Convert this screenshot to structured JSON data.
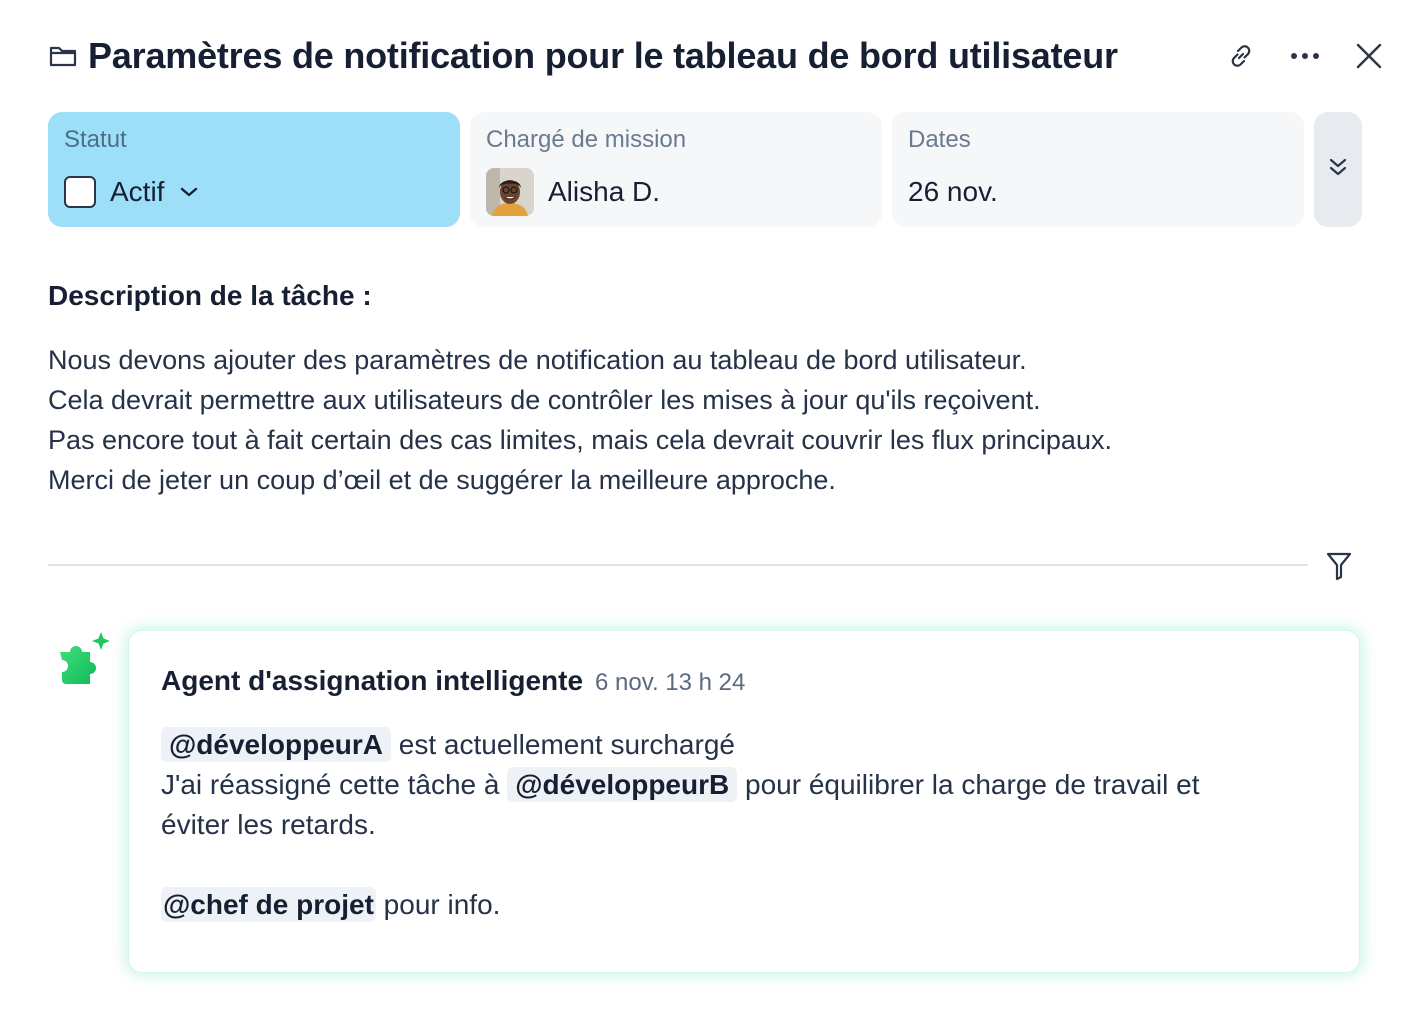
{
  "header": {
    "title": "Paramètres de notification pour le tableau de bord utilisateur",
    "icons": [
      "folder-icon",
      "link-icon",
      "more-icon",
      "close-icon"
    ]
  },
  "fields": {
    "status": {
      "label": "Statut",
      "value": "Actif",
      "color": "#9ddff9"
    },
    "assignee": {
      "label": "Chargé de mission",
      "value": "Alisha D."
    },
    "dates": {
      "label": "Dates",
      "value": "26 nov."
    }
  },
  "description": {
    "title": "Description de la tâche :",
    "lines": [
      "Nous devons ajouter des paramètres de notification au tableau de bord utilisateur.",
      "Cela devrait permettre aux utilisateurs de contrôler les mises à jour qu'ils reçoivent.",
      "Pas encore tout à fait certain des cas limites, mais cela devrait couvrir les flux principaux.",
      "Merci de jeter un coup d’œil et de suggérer la meilleure approche."
    ]
  },
  "comment": {
    "author": "Agent d'assignation intelligente",
    "time": "6 nov. 13 h 24",
    "accent": "#22c55e",
    "mention_a": "@développeurA",
    "text_1": "est actuellement surchargé",
    "text_2a": "J'ai réassigné cette tâche à",
    "mention_b": "@développeurB",
    "text_2b": "pour équilibrer la charge de travail et",
    "text_3": "éviter les retards.",
    "mention_c": "@chef de projet",
    "text_4": "pour info."
  }
}
